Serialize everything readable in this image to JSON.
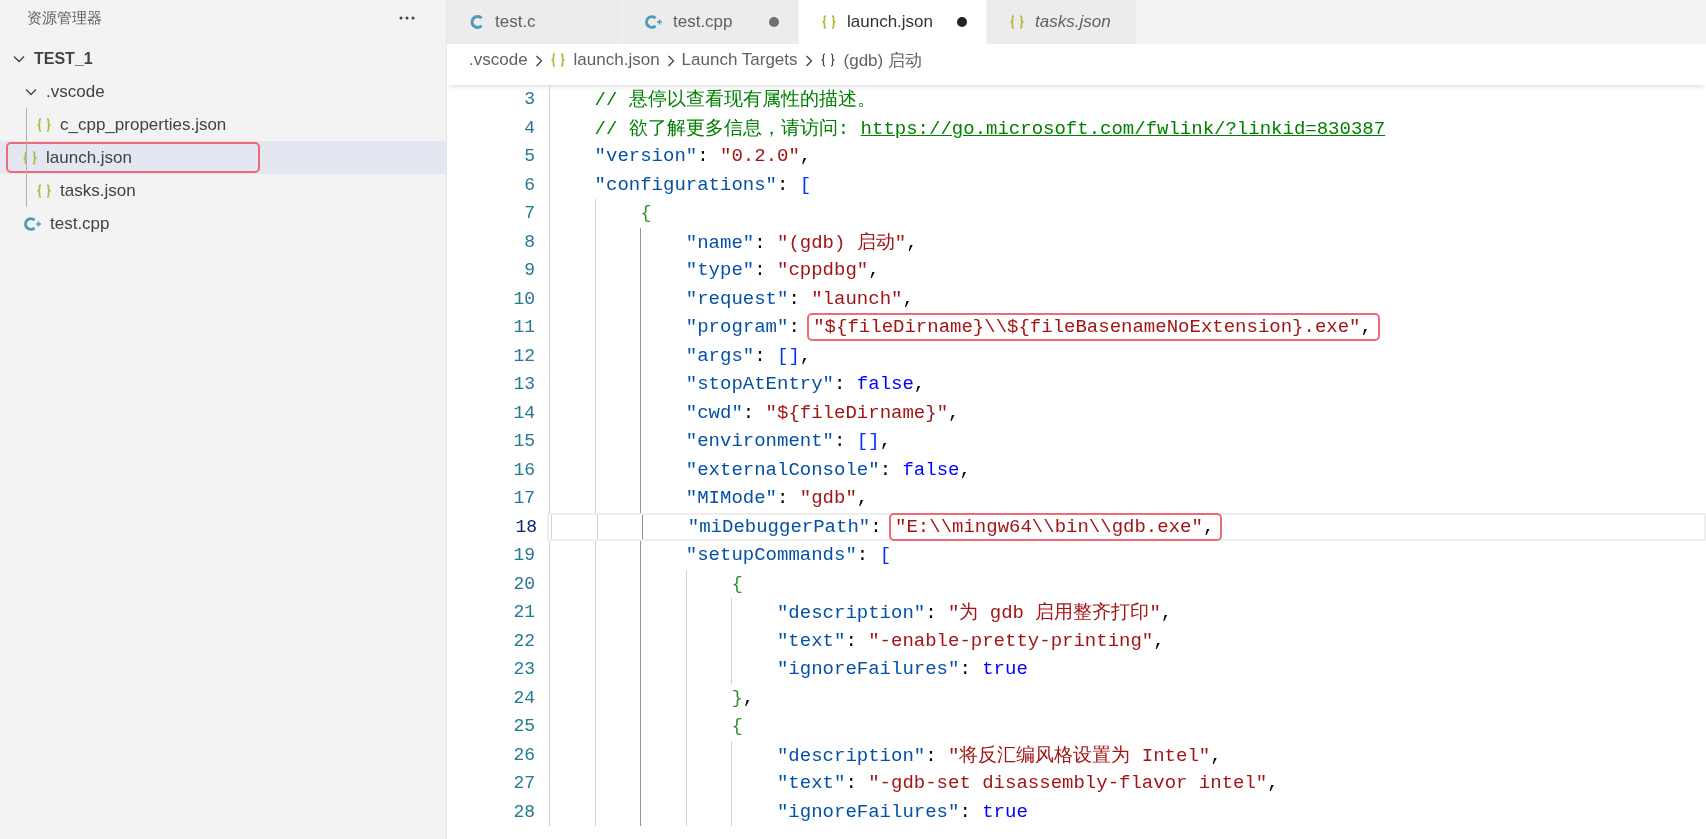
{
  "sidebar": {
    "title": "资源管理器",
    "tree": [
      {
        "kind": "root",
        "label": "TEST_1",
        "expanded": true,
        "selected": false,
        "highlighted": false,
        "children": [
          {
            "kind": "folder",
            "label": ".vscode",
            "expanded": true,
            "selected": false,
            "highlighted": false,
            "children": [
              {
                "kind": "json-file",
                "label": "c_cpp_properties.json",
                "selected": false,
                "highlighted": false
              },
              {
                "kind": "json-file",
                "label": "launch.json",
                "selected": true,
                "highlighted": true
              },
              {
                "kind": "json-file",
                "label": "tasks.json",
                "selected": false,
                "highlighted": false
              }
            ]
          },
          {
            "kind": "cpp-file",
            "label": "test.cpp",
            "selected": false,
            "highlighted": false
          }
        ]
      }
    ]
  },
  "tabs": [
    {
      "kind": "c-file",
      "label": "test.c",
      "selected": false,
      "dirty": false,
      "preview": false
    },
    {
      "kind": "cpp-file",
      "label": "test.cpp",
      "selected": false,
      "dirty": true,
      "preview": false
    },
    {
      "kind": "json-file",
      "label": "launch.json",
      "selected": true,
      "dirty": true,
      "preview": false
    },
    {
      "kind": "json-file",
      "label": "tasks.json",
      "selected": false,
      "dirty": false,
      "preview": true
    }
  ],
  "breadcrumb": [
    {
      "kind": "folder",
      "label": ".vscode"
    },
    {
      "kind": "json-file",
      "label": "launch.json"
    },
    {
      "kind": "section",
      "label": "Launch Targets"
    },
    {
      "kind": "object",
      "label": "(gdb) 启动"
    }
  ],
  "editor": {
    "lines": [
      {
        "number": "3",
        "current": false,
        "guides": [
          {
            "active": false
          }
        ],
        "tokens": [
          {
            "kind": "comment",
            "text": "// 悬停以查看现有属性的描述。"
          }
        ]
      },
      {
        "number": "4",
        "current": false,
        "guides": [
          {
            "active": false
          }
        ],
        "tokens": [
          {
            "kind": "comment",
            "text": "// 欲了解更多信息，请访问: "
          },
          {
            "kind": "link",
            "text": "https://go.microsoft.com/fwlink/?linkid=830387"
          }
        ]
      },
      {
        "number": "5",
        "current": false,
        "guides": [
          {
            "active": false
          }
        ],
        "tokens": [
          {
            "kind": "key",
            "text": "\"version\""
          },
          {
            "kind": "punct",
            "text": ": "
          },
          {
            "kind": "string",
            "text": "\"0.2.0\""
          },
          {
            "kind": "punct",
            "text": ","
          }
        ]
      },
      {
        "number": "6",
        "current": false,
        "guides": [
          {
            "active": false
          }
        ],
        "tokens": [
          {
            "kind": "key",
            "text": "\"configurations\""
          },
          {
            "kind": "punct",
            "text": ": "
          },
          {
            "kind": "array-bracket",
            "text": "["
          }
        ]
      },
      {
        "number": "7",
        "current": false,
        "guides": [
          {
            "active": false
          },
          {
            "active": false
          }
        ],
        "tokens": [
          {
            "kind": "object-bracket",
            "text": "{"
          }
        ]
      },
      {
        "number": "8",
        "current": false,
        "guides": [
          {
            "active": false
          },
          {
            "active": false
          },
          {
            "active": true
          }
        ],
        "tokens": [
          {
            "kind": "key",
            "text": "\"name\""
          },
          {
            "kind": "punct",
            "text": ": "
          },
          {
            "kind": "string",
            "text": "\"(gdb) 启动\""
          },
          {
            "kind": "punct",
            "text": ","
          }
        ]
      },
      {
        "number": "9",
        "current": false,
        "guides": [
          {
            "active": false
          },
          {
            "active": false
          },
          {
            "active": true
          }
        ],
        "tokens": [
          {
            "kind": "key",
            "text": "\"type\""
          },
          {
            "kind": "punct",
            "text": ": "
          },
          {
            "kind": "string",
            "text": "\"cppdbg\""
          },
          {
            "kind": "punct",
            "text": ","
          }
        ]
      },
      {
        "number": "10",
        "current": false,
        "guides": [
          {
            "active": false
          },
          {
            "active": false
          },
          {
            "active": true
          }
        ],
        "tokens": [
          {
            "kind": "key",
            "text": "\"request\""
          },
          {
            "kind": "punct",
            "text": ": "
          },
          {
            "kind": "string",
            "text": "\"launch\""
          },
          {
            "kind": "punct",
            "text": ","
          }
        ]
      },
      {
        "number": "11",
        "current": false,
        "guides": [
          {
            "active": false
          },
          {
            "active": false
          },
          {
            "active": true
          }
        ],
        "tokens": [
          {
            "kind": "key",
            "text": "\"program\""
          },
          {
            "kind": "punct",
            "text": ": "
          },
          {
            "kind": "boxed",
            "tokens": [
              {
                "kind": "string",
                "text": "\"${fileDirname}\\\\${fileBasenameNoExtension}.exe\""
              },
              {
                "kind": "punct",
                "text": ","
              }
            ]
          }
        ]
      },
      {
        "number": "12",
        "current": false,
        "guides": [
          {
            "active": false
          },
          {
            "active": false
          },
          {
            "active": true
          }
        ],
        "tokens": [
          {
            "kind": "key",
            "text": "\"args\""
          },
          {
            "kind": "punct",
            "text": ": "
          },
          {
            "kind": "array-bracket",
            "text": "[]"
          },
          {
            "kind": "punct",
            "text": ","
          }
        ]
      },
      {
        "number": "13",
        "current": false,
        "guides": [
          {
            "active": false
          },
          {
            "active": false
          },
          {
            "active": true
          }
        ],
        "tokens": [
          {
            "kind": "key",
            "text": "\"stopAtEntry\""
          },
          {
            "kind": "punct",
            "text": ": "
          },
          {
            "kind": "keyword",
            "text": "false"
          },
          {
            "kind": "punct",
            "text": ","
          }
        ]
      },
      {
        "number": "14",
        "current": false,
        "guides": [
          {
            "active": false
          },
          {
            "active": false
          },
          {
            "active": true
          }
        ],
        "tokens": [
          {
            "kind": "key",
            "text": "\"cwd\""
          },
          {
            "kind": "punct",
            "text": ": "
          },
          {
            "kind": "string",
            "text": "\"${fileDirname}\""
          },
          {
            "kind": "punct",
            "text": ","
          }
        ]
      },
      {
        "number": "15",
        "current": false,
        "guides": [
          {
            "active": false
          },
          {
            "active": false
          },
          {
            "active": true
          }
        ],
        "tokens": [
          {
            "kind": "key",
            "text": "\"environment\""
          },
          {
            "kind": "punct",
            "text": ": "
          },
          {
            "kind": "array-bracket",
            "text": "[]"
          },
          {
            "kind": "punct",
            "text": ","
          }
        ]
      },
      {
        "number": "16",
        "current": false,
        "guides": [
          {
            "active": false
          },
          {
            "active": false
          },
          {
            "active": true
          }
        ],
        "tokens": [
          {
            "kind": "key",
            "text": "\"externalConsole\""
          },
          {
            "kind": "punct",
            "text": ": "
          },
          {
            "kind": "keyword",
            "text": "false"
          },
          {
            "kind": "punct",
            "text": ","
          }
        ]
      },
      {
        "number": "17",
        "current": false,
        "guides": [
          {
            "active": false
          },
          {
            "active": false
          },
          {
            "active": true
          }
        ],
        "tokens": [
          {
            "kind": "key",
            "text": "\"MIMode\""
          },
          {
            "kind": "punct",
            "text": ": "
          },
          {
            "kind": "string",
            "text": "\"gdb\""
          },
          {
            "kind": "punct",
            "text": ","
          }
        ]
      },
      {
        "number": "18",
        "current": true,
        "guides": [
          {
            "active": false
          },
          {
            "active": false
          },
          {
            "active": true
          }
        ],
        "tokens": [
          {
            "kind": "key",
            "text": "\"miDebuggerPath\""
          },
          {
            "kind": "punct",
            "text": ": "
          },
          {
            "kind": "boxed",
            "tokens": [
              {
                "kind": "string",
                "text": "\"E:\\\\mingw64\\\\bin\\\\gdb.exe\""
              },
              {
                "kind": "punct",
                "text": ","
              }
            ]
          }
        ]
      },
      {
        "number": "19",
        "current": false,
        "guides": [
          {
            "active": false
          },
          {
            "active": false
          },
          {
            "active": true
          }
        ],
        "tokens": [
          {
            "kind": "key",
            "text": "\"setupCommands\""
          },
          {
            "kind": "punct",
            "text": ": "
          },
          {
            "kind": "array-bracket",
            "text": "["
          }
        ]
      },
      {
        "number": "20",
        "current": false,
        "guides": [
          {
            "active": false
          },
          {
            "active": false
          },
          {
            "active": true
          },
          {
            "active": false
          }
        ],
        "tokens": [
          {
            "kind": "object-bracket",
            "text": "{"
          }
        ]
      },
      {
        "number": "21",
        "current": false,
        "guides": [
          {
            "active": false
          },
          {
            "active": false
          },
          {
            "active": true
          },
          {
            "active": false
          },
          {
            "active": false
          }
        ],
        "tokens": [
          {
            "kind": "key",
            "text": "\"description\""
          },
          {
            "kind": "punct",
            "text": ": "
          },
          {
            "kind": "string",
            "text": "\"为 gdb 启用整齐打印\""
          },
          {
            "kind": "punct",
            "text": ","
          }
        ]
      },
      {
        "number": "22",
        "current": false,
        "guides": [
          {
            "active": false
          },
          {
            "active": false
          },
          {
            "active": true
          },
          {
            "active": false
          },
          {
            "active": false
          }
        ],
        "tokens": [
          {
            "kind": "key",
            "text": "\"text\""
          },
          {
            "kind": "punct",
            "text": ": "
          },
          {
            "kind": "string",
            "text": "\"-enable-pretty-printing\""
          },
          {
            "kind": "punct",
            "text": ","
          }
        ]
      },
      {
        "number": "23",
        "current": false,
        "guides": [
          {
            "active": false
          },
          {
            "active": false
          },
          {
            "active": true
          },
          {
            "active": false
          },
          {
            "active": false
          }
        ],
        "tokens": [
          {
            "kind": "key",
            "text": "\"ignoreFailures\""
          },
          {
            "kind": "punct",
            "text": ": "
          },
          {
            "kind": "keyword",
            "text": "true"
          }
        ]
      },
      {
        "number": "24",
        "current": false,
        "guides": [
          {
            "active": false
          },
          {
            "active": false
          },
          {
            "active": true
          },
          {
            "active": false
          }
        ],
        "tokens": [
          {
            "kind": "object-bracket",
            "text": "}"
          },
          {
            "kind": "punct",
            "text": ","
          }
        ]
      },
      {
        "number": "25",
        "current": false,
        "guides": [
          {
            "active": false
          },
          {
            "active": false
          },
          {
            "active": true
          },
          {
            "active": false
          }
        ],
        "tokens": [
          {
            "kind": "object-bracket",
            "text": "{"
          }
        ]
      },
      {
        "number": "26",
        "current": false,
        "guides": [
          {
            "active": false
          },
          {
            "active": false
          },
          {
            "active": true
          },
          {
            "active": false
          },
          {
            "active": false
          }
        ],
        "tokens": [
          {
            "kind": "key",
            "text": "\"description\""
          },
          {
            "kind": "punct",
            "text": ": "
          },
          {
            "kind": "string",
            "text": "\"将反汇编风格设置为 Intel\""
          },
          {
            "kind": "punct",
            "text": ","
          }
        ]
      },
      {
        "number": "27",
        "current": false,
        "guides": [
          {
            "active": false
          },
          {
            "active": false
          },
          {
            "active": true
          },
          {
            "active": false
          },
          {
            "active": false
          }
        ],
        "tokens": [
          {
            "kind": "key",
            "text": "\"text\""
          },
          {
            "kind": "punct",
            "text": ": "
          },
          {
            "kind": "string",
            "text": "\"-gdb-set disassembly-flavor intel\""
          },
          {
            "kind": "punct",
            "text": ","
          }
        ]
      },
      {
        "number": "28",
        "current": false,
        "guides": [
          {
            "active": false
          },
          {
            "active": false
          },
          {
            "active": true
          },
          {
            "active": false
          },
          {
            "active": false
          }
        ],
        "tokens": [
          {
            "kind": "key",
            "text": "\"ignoreFailures\""
          },
          {
            "kind": "punct",
            "text": ": "
          },
          {
            "kind": "keyword",
            "text": "true"
          }
        ]
      }
    ]
  }
}
